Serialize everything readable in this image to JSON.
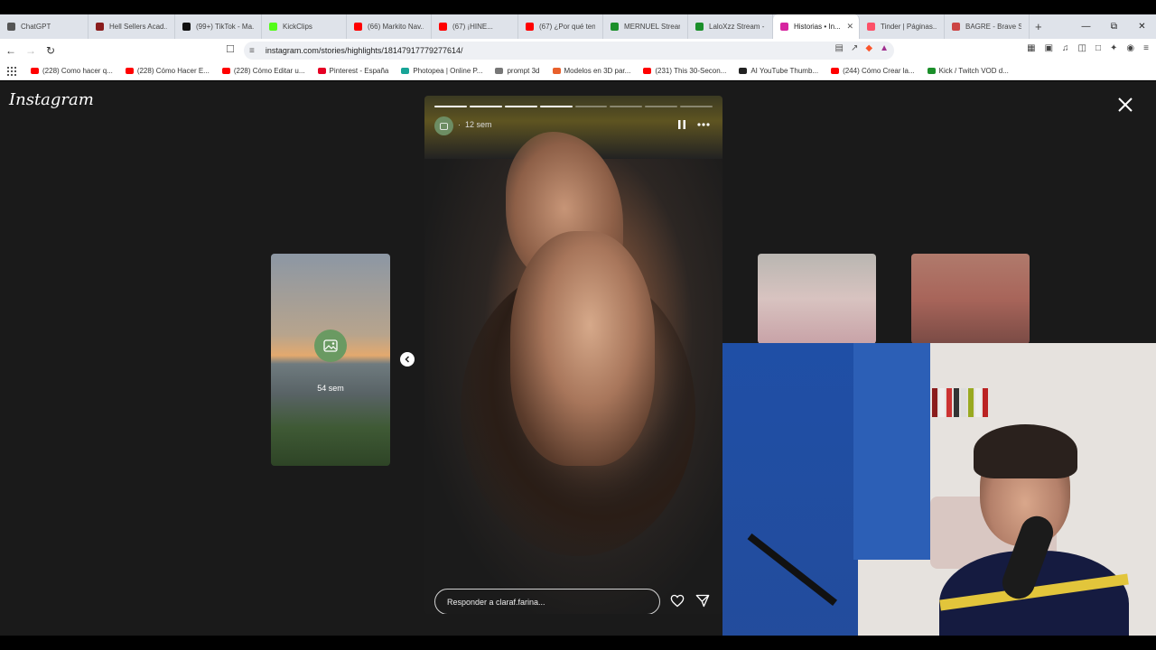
{
  "browser": {
    "tabs": [
      {
        "label": "ChatGPT",
        "color": "#555555",
        "active": false,
        "width": 98
      },
      {
        "label": "Hell Sellers Acad...",
        "color": "#8a1c1c",
        "active": false,
        "width": 96
      },
      {
        "label": "(99+) TikTok - Ma...",
        "color": "#111111",
        "active": false,
        "width": 96
      },
      {
        "label": "KickClips",
        "color": "#53fc18",
        "active": false,
        "width": 94
      },
      {
        "label": "(66) Markito Nav...",
        "color": "#ff0000",
        "active": false,
        "width": 94
      },
      {
        "label": "(67) ¡HINE...",
        "color": "#ff0000",
        "active": false,
        "width": 96
      },
      {
        "label": "(67) ¿Por qué ten...",
        "color": "#ff0000",
        "active": false,
        "width": 94
      },
      {
        "label": "MERNUEL Stream...",
        "color": "#1b8f2a",
        "active": false,
        "width": 94
      },
      {
        "label": "LaloXzz Stream -...",
        "color": "#1b8f2a",
        "active": false,
        "width": 94
      },
      {
        "label": "Historias • In...",
        "color": "#d6249f",
        "active": true,
        "width": 96
      },
      {
        "label": "Tinder | Páginas...",
        "color": "#fd5068",
        "active": false,
        "width": 94
      },
      {
        "label": "BAGRE - Brave Se...",
        "color": "#c44",
        "active": false,
        "width": 94
      }
    ],
    "tab_close": "✕",
    "new_tab": "+",
    "url": "instagram.com/stories/highlights/18147917779277614/",
    "bookmarks": [
      {
        "label": "(228) Como hacer q...",
        "color": "#ff0000"
      },
      {
        "label": "(228) Cómo Hacer E...",
        "color": "#ff0000"
      },
      {
        "label": "(228) Cómo Editar u...",
        "color": "#ff0000"
      },
      {
        "label": "Pinterest - España",
        "color": "#e60023"
      },
      {
        "label": "Photopea | Online P...",
        "color": "#18a497"
      },
      {
        "label": "prompt 3d",
        "color": "#777777"
      },
      {
        "label": "Modelos en 3D par...",
        "color": "#e8602c"
      },
      {
        "label": "(231) This 30-Secon...",
        "color": "#ff0000"
      },
      {
        "label": "AI YouTube Thumb...",
        "color": "#222222"
      },
      {
        "label": "(244) Cómo Crear la...",
        "color": "#ff0000"
      },
      {
        "label": "Kick / Twitch VOD d...",
        "color": "#1b8f2a"
      }
    ]
  },
  "instagram": {
    "logo": "Instagram",
    "story": {
      "time": "12 sem",
      "segments_total": 8,
      "segments_done": 4,
      "reply_placeholder": "Responder a claraf.farina..."
    },
    "left_card": {
      "time": "54 sem"
    }
  }
}
